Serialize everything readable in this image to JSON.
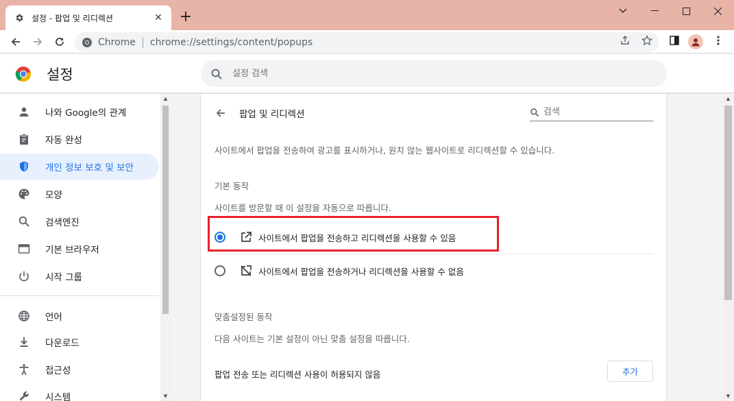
{
  "window": {
    "tab_title": "설정 - 팝업 및 리디렉션",
    "tab_icon": "gear-icon",
    "new_tab_label": "+"
  },
  "toolbar": {
    "chip_label": "Chrome",
    "url": "chrome://settings/content/popups"
  },
  "header": {
    "title": "설정",
    "search_placeholder": "설정 검색"
  },
  "sidebar": {
    "items": [
      {
        "label": "나와 Google의 관계",
        "icon": "person-icon"
      },
      {
        "label": "자동 완성",
        "icon": "clipboard-icon"
      },
      {
        "label": "개인 정보 보호 및 보안",
        "icon": "shield-icon",
        "active": true
      },
      {
        "label": "모양",
        "icon": "palette-icon"
      },
      {
        "label": "검색엔진",
        "icon": "search-icon"
      },
      {
        "label": "기본 브라우저",
        "icon": "browser-icon"
      },
      {
        "label": "시작 그룹",
        "icon": "power-icon"
      },
      {
        "label": "언어",
        "icon": "globe-icon"
      },
      {
        "label": "다운로드",
        "icon": "download-icon"
      },
      {
        "label": "접근성",
        "icon": "accessibility-icon"
      },
      {
        "label": "시스템",
        "icon": "wrench-icon"
      }
    ]
  },
  "page": {
    "title": "팝업 및 리디렉션",
    "search_placeholder": "검색",
    "description": "사이트에서 팝업을 전송하여 광고를 표시하거나, 원치 않는 웹사이트로 리디렉션할 수 있습니다.",
    "default_heading": "기본 동작",
    "default_desc": "사이트를 방문할 때 이 설정을 자동으로 따릅니다.",
    "options": [
      {
        "label": "사이트에서 팝업을 전송하고 리디렉션을 사용할 수 있음",
        "checked": true,
        "icon": "open-in-new-icon"
      },
      {
        "label": "사이트에서 팝업을 전송하거나 리디렉션을 사용할 수 없음",
        "checked": false,
        "icon": "popup-blocked-icon"
      }
    ],
    "custom_heading": "맞춤설정된 동작",
    "custom_desc": "다음 사이트는 기본 설정이 아닌 맞춤 설정을 따릅니다.",
    "not_allowed_label": "팝업 전송 또는 리디렉션 사용이 허용되지 않음",
    "add_button": "추가"
  },
  "colors": {
    "accent": "#1a73e8",
    "highlight": "#e8202a",
    "titlebar": "#e8b4a8"
  }
}
